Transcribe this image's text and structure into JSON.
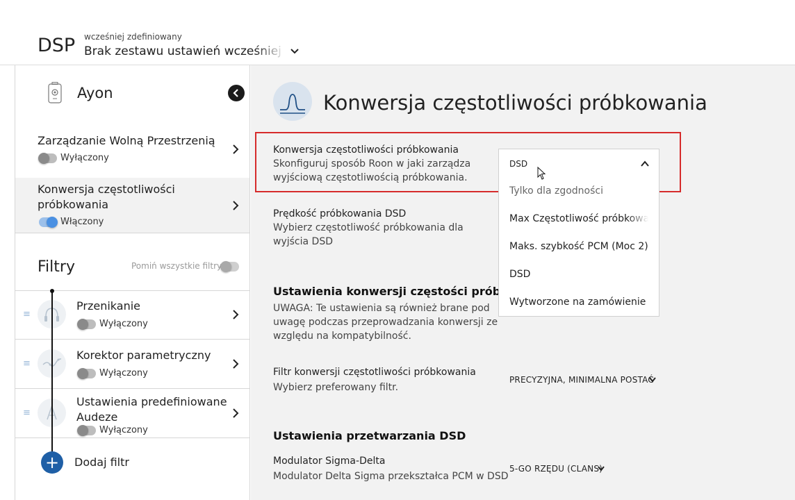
{
  "header": {
    "title": "DSP",
    "preset_caption": "wcześniej zdefiniowany",
    "preset_value": "Brak zestawu ustawień wcześniej zdefiniowanych"
  },
  "sidebar": {
    "device_name": "Ayon",
    "items": [
      {
        "label": "Zarządzanie Wolną Przestrzenią",
        "status": "Wyłączony",
        "enabled": false
      },
      {
        "label": "Konwersja częstotliwości próbkowania",
        "status": "Włączony",
        "enabled": true
      }
    ],
    "filters_title": "Filtry",
    "bypass_all_label": "Pomiń wszystkie filtry",
    "filters": [
      {
        "name": "Przenikanie",
        "status": "Wyłączony",
        "icon": "headphones-icon"
      },
      {
        "name": "Korektor parametryczny",
        "status": "Wyłączony",
        "icon": "eq-curve-icon"
      },
      {
        "name": "Ustawienia predefiniowane Audeze",
        "status": "Wyłączony",
        "icon": "audeze-icon"
      }
    ],
    "add_filter_label": "Dodaj filtr"
  },
  "main": {
    "title": "Konwersja częstotliwości próbkowania",
    "sample_rate_conversion": {
      "label": "Konwersja częstotliwości próbkowania",
      "desc": "Skonfiguruj sposób Roon w jaki zarządza wyjściową częstotliwością próbkowania.",
      "selected": "DSD",
      "options": [
        "Tylko dla zgodności",
        "Max Częstotliwość próbkowania",
        "Maks. szybkość PCM (Moc 2)",
        "DSD",
        "Wytworzone na zamówienie"
      ]
    },
    "dsd_rate": {
      "label": "Prędkość próbkowania DSD",
      "desc": "Wybierz częstotliwość próbkowania dla wyjścia DSD"
    },
    "conversion_settings": {
      "heading": "Ustawienia konwersji częstości próbkowania",
      "note": "UWAGA: Te ustawienia są również brane pod uwagę podczas przeprowadzania konwersji ze względu na kompatybilność."
    },
    "filter": {
      "label": "Filtr konwersji częstotliwości próbkowania",
      "desc": "Wybierz preferowany filtr.",
      "value": "PRECYZYJNA, MINIMALNA POSTAĆ"
    },
    "dsd_processing": {
      "heading": "Ustawienia przetwarzania DSD",
      "modulator_label": "Modulator Sigma-Delta",
      "modulator_desc": "Modulator Delta Sigma przekształca PCM w DSD",
      "modulator_value": "5-GO RZĘDU (CLANS)"
    }
  },
  "colors": {
    "accent": "#4a90e2",
    "add_button": "#1f5fa6",
    "highlight": "#d62b2b"
  }
}
